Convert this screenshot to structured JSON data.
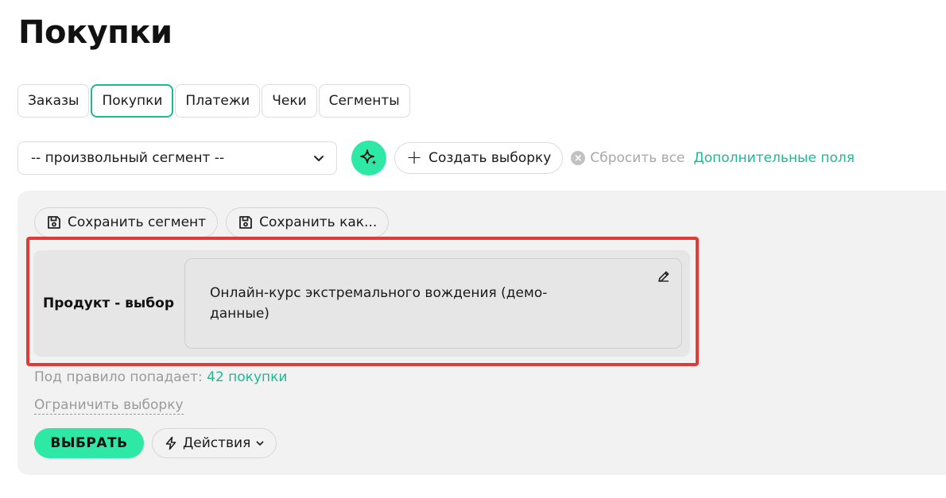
{
  "page": {
    "title": "Покупки"
  },
  "tabs": [
    {
      "label": "Заказы",
      "active": false
    },
    {
      "label": "Покупки",
      "active": true
    },
    {
      "label": "Платежи",
      "active": false
    },
    {
      "label": "Чеки",
      "active": false
    },
    {
      "label": "Сегменты",
      "active": false
    }
  ],
  "toolbar": {
    "segment_select_value": "-- произвольный сегмент --",
    "ai_icon": "sparkle-icon",
    "create_label": "Создать выборку",
    "reset_label": "Сбросить все",
    "extra_fields_label": "Дополнительные поля"
  },
  "panel": {
    "save_segment_label": "Сохранить сегмент",
    "save_as_label": "Сохранить как...",
    "rule": {
      "label": "Продукт - выбор",
      "value": "Онлайн-курс экстремального вождения (демо-данные)",
      "edit_icon": "pencil-icon"
    },
    "match_prefix": "Под правило попадает:",
    "match_count": "42 покупки",
    "limit_label": "Ограничить выборку",
    "select_label": "ВЫБРАТЬ",
    "actions_label": "Действия"
  },
  "colors": {
    "accent": "#2ee8a6",
    "accent_text": "#1fb894",
    "highlight": "#e53935",
    "panel_bg": "#f2f2f2"
  }
}
